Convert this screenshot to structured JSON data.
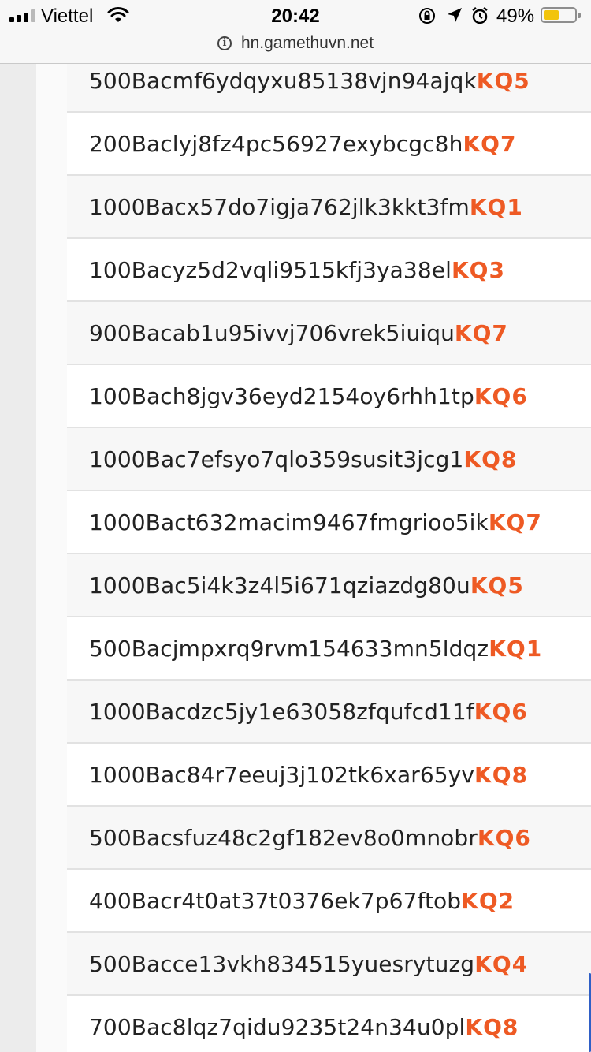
{
  "status": {
    "carrier": "Viettel",
    "time": "20:42",
    "battery_percent": "49%",
    "battery_level": 0.49
  },
  "address_bar": {
    "url": "hn.gamethuvn.net"
  },
  "rows": [
    {
      "code": "500Bacmf6ydqyxu85138vjn94ajqk",
      "tag": "KQ5"
    },
    {
      "code": "200Baclyj8fz4pc56927exybcgc8h",
      "tag": "KQ7"
    },
    {
      "code": "1000Bacx57do7igja762jlk3kkt3fm",
      "tag": "KQ1"
    },
    {
      "code": "100Bacyz5d2vqli9515kfj3ya38el",
      "tag": "KQ3"
    },
    {
      "code": "900Bacab1u95ivvj706vrek5iuiqu",
      "tag": "KQ7"
    },
    {
      "code": "100Bach8jgv36eyd2154oy6rhh1tp",
      "tag": "KQ6"
    },
    {
      "code": "1000Bac7efsyo7qlo359susit3jcg1",
      "tag": "KQ8"
    },
    {
      "code": "1000Bact632macim9467fmgrioo5ik",
      "tag": "KQ7"
    },
    {
      "code": "1000Bac5i4k3z4l5i671qziazdg80u",
      "tag": "KQ5"
    },
    {
      "code": "500Bacjmpxrq9rvm154633mn5ldqz",
      "tag": "KQ1"
    },
    {
      "code": "1000Bacdzc5jy1e63058zfqufcd11f",
      "tag": "KQ6"
    },
    {
      "code": "1000Bac84r7eeuj3j102tk6xar65yv",
      "tag": "KQ8"
    },
    {
      "code": "500Bacsfuz48c2gf182ev8o0mnobr",
      "tag": "KQ6"
    },
    {
      "code": "400Bacr4t0at37t0376ek7p67ftob",
      "tag": "KQ2"
    },
    {
      "code": "500Bacce13vkh834515yuesrytuzg",
      "tag": "KQ4"
    },
    {
      "code": "700Bac8lqz7qidu9235t24n34u0pl",
      "tag": "KQ8"
    }
  ],
  "colors": {
    "accent": "#ee5a24",
    "row_odd": "#f7f7f7",
    "row_even": "#ffffff"
  }
}
